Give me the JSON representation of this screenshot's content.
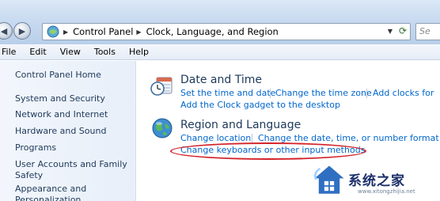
{
  "address": {
    "crumbs": [
      "Control Panel",
      "Clock, Language, and Region"
    ],
    "search_placeholder": "Se"
  },
  "menu": [
    "File",
    "Edit",
    "View",
    "Tools",
    "Help"
  ],
  "sidebar": {
    "items": [
      {
        "label": "Control Panel Home"
      },
      {
        "label": "System and Security"
      },
      {
        "label": "Network and Internet"
      },
      {
        "label": "Hardware and Sound"
      },
      {
        "label": "Programs"
      },
      {
        "label": "User Accounts and Family"
      },
      {
        "label": "Safety"
      },
      {
        "label": "Appearance and"
      },
      {
        "label": "Personalization"
      }
    ]
  },
  "main": {
    "categories": [
      {
        "title": "Date and Time",
        "icon": "clock-calendar-icon",
        "tasks": [
          "Set the time and date",
          "Change the time zone",
          "Add clocks for",
          "Add the Clock gadget to the desktop"
        ]
      },
      {
        "title": "Region and Language",
        "icon": "globe-icon",
        "tasks": [
          "Change location",
          "Change the date, time, or number format",
          "Change keyboards or other input methods"
        ]
      }
    ]
  },
  "watermark": {
    "text": "系统之家",
    "sub": "www.xitongzhijia.net"
  },
  "colors": {
    "link": "#0066cc",
    "heading": "#1e395b",
    "highlight": "#d2232a"
  }
}
